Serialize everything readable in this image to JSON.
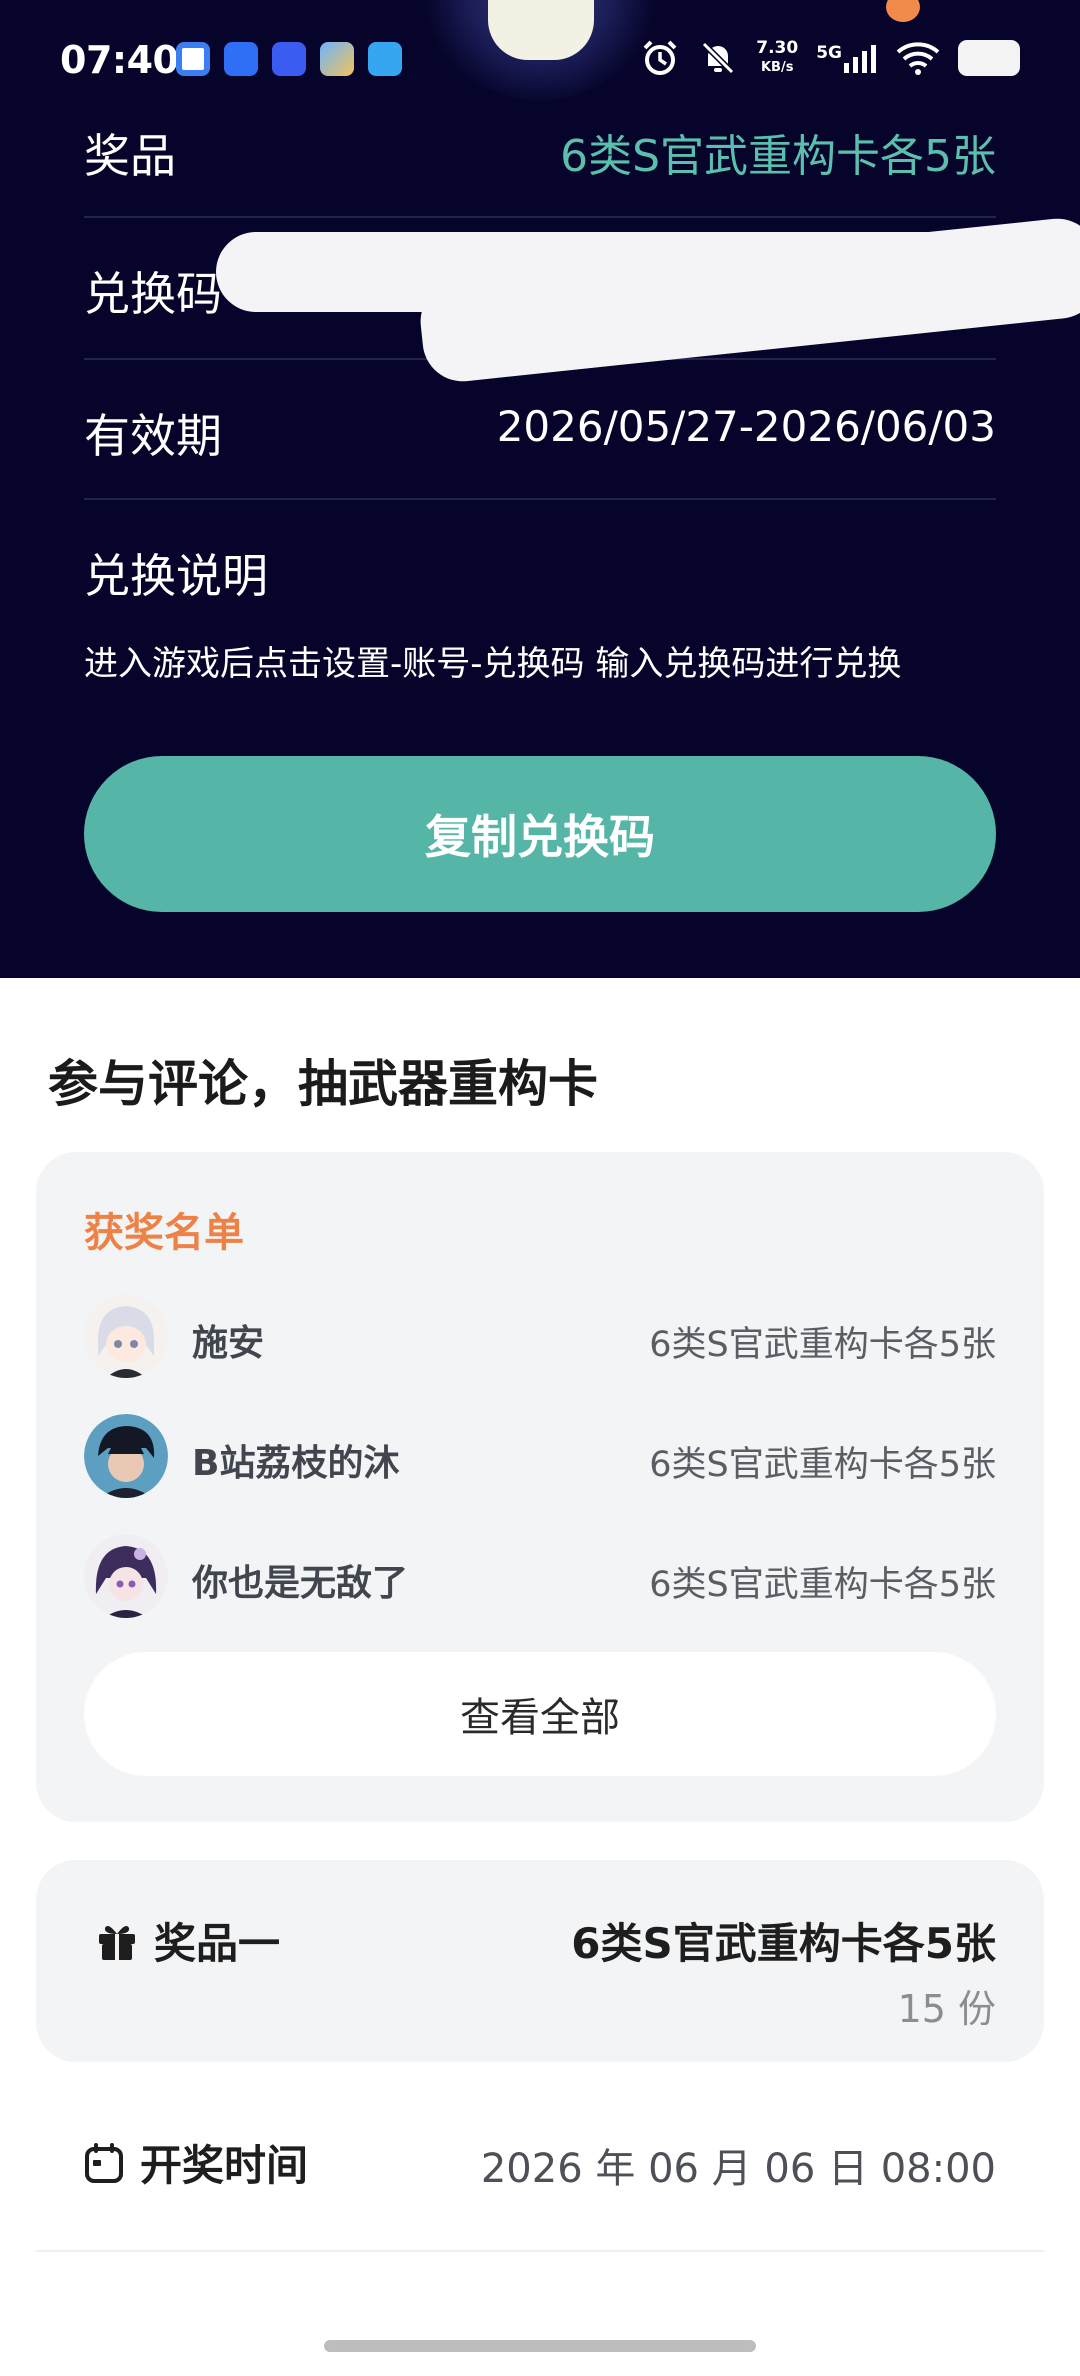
{
  "status_bar": {
    "time": "07:40",
    "net_speed_value": "7.30",
    "net_speed_unit": "KB/s",
    "network": "5G",
    "icons": [
      "app-icon-cloud",
      "app-icon-browser",
      "vivo-icon",
      "app-icon-store",
      "app-icon-message",
      "alarm-icon",
      "mute-icon",
      "signal-icon",
      "wifi-icon",
      "battery-icon"
    ]
  },
  "redeem": {
    "prize_label": "奖品",
    "prize_value": "6类S官武重构卡各5张",
    "code_label": "兑换码",
    "validity_label": "有效期",
    "validity_value": "2026/05/27-2026/06/03",
    "desc_title": "兑换说明",
    "desc_text": "进入游戏后点击设置-账号-兑换码 输入兑换码进行兑换",
    "copy_button": "复制兑换码"
  },
  "section_title": "参与评论，抽武器重构卡",
  "winners": {
    "heading": "获奖名单",
    "list": [
      {
        "name": "施安",
        "prize": "6类S官武重构卡各5张"
      },
      {
        "name": "B站荔枝的沐",
        "prize": "6类S官武重构卡各5张"
      },
      {
        "name": "你也是无敌了",
        "prize": "6类S官武重构卡各5张"
      }
    ],
    "view_all": "查看全部"
  },
  "prize_card": {
    "label": "奖品一",
    "name": "6类S官武重构卡各5张",
    "count": "15 份"
  },
  "draw": {
    "label": "开奖时间",
    "time": "2026 年 06 月 06 日 08:00"
  },
  "colors": {
    "dark_bg": "#06042a",
    "accent_teal": "#55b5a6",
    "prize_teal_text": "#5bbfae",
    "winner_orange": "#ee8246"
  }
}
